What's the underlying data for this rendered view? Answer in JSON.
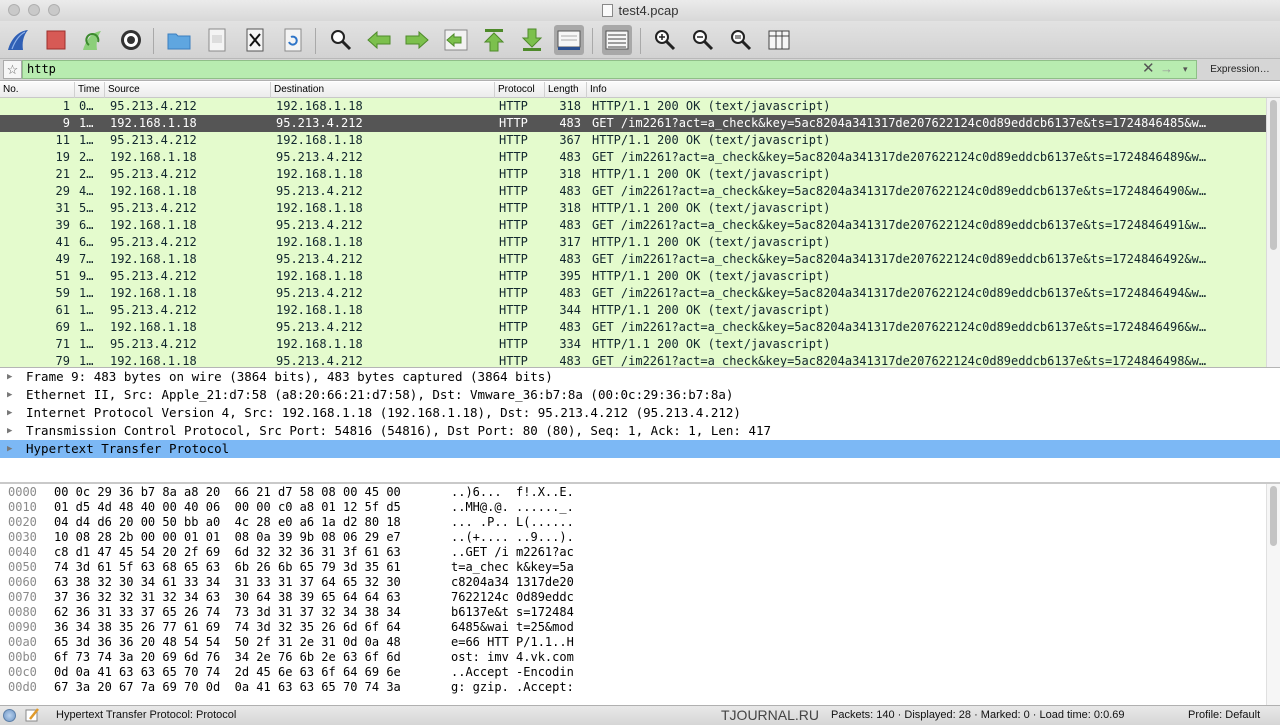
{
  "window": {
    "title": "test4.pcap",
    "doc_icon": "pcap-file-icon"
  },
  "toolbar": {
    "icons": [
      "shark-fin-start-icon",
      "stop-icon",
      "shark-fin-restart-icon",
      "gear-options-icon",
      "folder-open-icon",
      "document-icon",
      "close-file-icon",
      "reload-icon",
      "search-icon",
      "arrow-back-icon",
      "arrow-forward-icon",
      "go-to-packet-icon",
      "first-packet-icon",
      "last-packet-icon",
      "autoscroll-icon",
      "colorize-icon",
      "zoom-in-icon",
      "zoom-out-icon",
      "normal-size-icon",
      "resize-columns-icon"
    ]
  },
  "filter": {
    "value": "http",
    "expression_label": "Expression…"
  },
  "packet_list": {
    "columns": [
      "No.",
      "Time",
      "Source",
      "Destination",
      "Protocol",
      "Length",
      "Info"
    ],
    "selected_index": 1,
    "rows": [
      {
        "no": "1",
        "time": "0…",
        "src": "95.213.4.212",
        "dst": "192.168.1.18",
        "proto": "HTTP",
        "len": "318",
        "info": "HTTP/1.1 200 OK  (text/javascript)"
      },
      {
        "no": "9",
        "time": "1…",
        "src": "192.168.1.18",
        "dst": "95.213.4.212",
        "proto": "HTTP",
        "len": "483",
        "info": "GET /im2261?act=a_check&key=5ac8204a341317de207622124c0d89eddcb6137e&ts=1724846485&w…"
      },
      {
        "no": "11",
        "time": "1…",
        "src": "95.213.4.212",
        "dst": "192.168.1.18",
        "proto": "HTTP",
        "len": "367",
        "info": "HTTP/1.1 200 OK  (text/javascript)"
      },
      {
        "no": "19",
        "time": "2…",
        "src": "192.168.1.18",
        "dst": "95.213.4.212",
        "proto": "HTTP",
        "len": "483",
        "info": "GET /im2261?act=a_check&key=5ac8204a341317de207622124c0d89eddcb6137e&ts=1724846489&w…"
      },
      {
        "no": "21",
        "time": "2…",
        "src": "95.213.4.212",
        "dst": "192.168.1.18",
        "proto": "HTTP",
        "len": "318",
        "info": "HTTP/1.1 200 OK  (text/javascript)"
      },
      {
        "no": "29",
        "time": "4…",
        "src": "192.168.1.18",
        "dst": "95.213.4.212",
        "proto": "HTTP",
        "len": "483",
        "info": "GET /im2261?act=a_check&key=5ac8204a341317de207622124c0d89eddcb6137e&ts=1724846490&w…"
      },
      {
        "no": "31",
        "time": "5…",
        "src": "95.213.4.212",
        "dst": "192.168.1.18",
        "proto": "HTTP",
        "len": "318",
        "info": "HTTP/1.1 200 OK  (text/javascript)"
      },
      {
        "no": "39",
        "time": "6…",
        "src": "192.168.1.18",
        "dst": "95.213.4.212",
        "proto": "HTTP",
        "len": "483",
        "info": "GET /im2261?act=a_check&key=5ac8204a341317de207622124c0d89eddcb6137e&ts=1724846491&w…"
      },
      {
        "no": "41",
        "time": "6…",
        "src": "95.213.4.212",
        "dst": "192.168.1.18",
        "proto": "HTTP",
        "len": "317",
        "info": "HTTP/1.1 200 OK  (text/javascript)"
      },
      {
        "no": "49",
        "time": "7…",
        "src": "192.168.1.18",
        "dst": "95.213.4.212",
        "proto": "HTTP",
        "len": "483",
        "info": "GET /im2261?act=a_check&key=5ac8204a341317de207622124c0d89eddcb6137e&ts=1724846492&w…"
      },
      {
        "no": "51",
        "time": "9…",
        "src": "95.213.4.212",
        "dst": "192.168.1.18",
        "proto": "HTTP",
        "len": "395",
        "info": "HTTP/1.1 200 OK  (text/javascript)"
      },
      {
        "no": "59",
        "time": "1…",
        "src": "192.168.1.18",
        "dst": "95.213.4.212",
        "proto": "HTTP",
        "len": "483",
        "info": "GET /im2261?act=a_check&key=5ac8204a341317de207622124c0d89eddcb6137e&ts=1724846494&w…"
      },
      {
        "no": "61",
        "time": "1…",
        "src": "95.213.4.212",
        "dst": "192.168.1.18",
        "proto": "HTTP",
        "len": "344",
        "info": "HTTP/1.1 200 OK  (text/javascript)"
      },
      {
        "no": "69",
        "time": "1…",
        "src": "192.168.1.18",
        "dst": "95.213.4.212",
        "proto": "HTTP",
        "len": "483",
        "info": "GET /im2261?act=a_check&key=5ac8204a341317de207622124c0d89eddcb6137e&ts=1724846496&w…"
      },
      {
        "no": "71",
        "time": "1…",
        "src": "95.213.4.212",
        "dst": "192.168.1.18",
        "proto": "HTTP",
        "len": "334",
        "info": "HTTP/1.1 200 OK  (text/javascript)"
      },
      {
        "no": "79",
        "time": "1…",
        "src": "192.168.1.18",
        "dst": "95.213.4.212",
        "proto": "HTTP",
        "len": "483",
        "info": "GET /im2261?act=a_check&key=5ac8204a341317de207622124c0d89eddcb6137e&ts=1724846498&w…"
      }
    ]
  },
  "details": {
    "selected_index": 4,
    "rows": [
      "Frame 9: 483 bytes on wire (3864 bits), 483 bytes captured (3864 bits)",
      "Ethernet II, Src: Apple_21:d7:58 (a8:20:66:21:d7:58), Dst: Vmware_36:b7:8a (00:0c:29:36:b7:8a)",
      "Internet Protocol Version 4, Src: 192.168.1.18 (192.168.1.18), Dst: 95.213.4.212 (95.213.4.212)",
      "Transmission Control Protocol, Src Port: 54816 (54816), Dst Port: 80 (80), Seq: 1, Ack: 1, Len: 417",
      "Hypertext Transfer Protocol"
    ]
  },
  "bytes": {
    "rows": [
      {
        "off": "0000",
        "hex": "00 0c 29 36 b7 8a a8 20  66 21 d7 58 08 00 45 00",
        "ascii": "..)6...  f!.X..E."
      },
      {
        "off": "0010",
        "hex": "01 d5 4d 48 40 00 40 06  00 00 c0 a8 01 12 5f d5",
        "ascii": "..MH@.@. ......_."
      },
      {
        "off": "0020",
        "hex": "04 d4 d6 20 00 50 bb a0  4c 28 e0 a6 1a d2 80 18",
        "ascii": "... .P.. L(......"
      },
      {
        "off": "0030",
        "hex": "10 08 28 2b 00 00 01 01  08 0a 39 9b 08 06 29 e7",
        "ascii": "..(+.... ..9...)."
      },
      {
        "off": "0040",
        "hex": "c8 d1 47 45 54 20 2f 69  6d 32 32 36 31 3f 61 63",
        "ascii": "..GET /i m2261?ac"
      },
      {
        "off": "0050",
        "hex": "74 3d 61 5f 63 68 65 63  6b 26 6b 65 79 3d 35 61",
        "ascii": "t=a_chec k&key=5a"
      },
      {
        "off": "0060",
        "hex": "63 38 32 30 34 61 33 34  31 33 31 37 64 65 32 30",
        "ascii": "c8204a34 1317de20"
      },
      {
        "off": "0070",
        "hex": "37 36 32 32 31 32 34 63  30 64 38 39 65 64 64 63",
        "ascii": "7622124c 0d89eddc"
      },
      {
        "off": "0080",
        "hex": "62 36 31 33 37 65 26 74  73 3d 31 37 32 34 38 34",
        "ascii": "b6137e&t s=172484"
      },
      {
        "off": "0090",
        "hex": "36 34 38 35 26 77 61 69  74 3d 32 35 26 6d 6f 64",
        "ascii": "6485&wai t=25&mod"
      },
      {
        "off": "00a0",
        "hex": "65 3d 36 36 20 48 54 54  50 2f 31 2e 31 0d 0a 48",
        "ascii": "e=66 HTT P/1.1..H"
      },
      {
        "off": "00b0",
        "hex": "6f 73 74 3a 20 69 6d 76  34 2e 76 6b 2e 63 6f 6d",
        "ascii": "ost: imv 4.vk.com"
      },
      {
        "off": "00c0",
        "hex": "0d 0a 41 63 63 65 70 74  2d 45 6e 63 6f 64 69 6e",
        "ascii": "..Accept -Encodin"
      },
      {
        "off": "00d0",
        "hex": "67 3a 20 67 7a 69 70 0d  0a 41 63 63 65 70 74 3a",
        "ascii": "g: gzip. .Accept:"
      }
    ]
  },
  "status": {
    "field": "Hypertext Transfer Protocol: Protocol",
    "watermark": "TJOURNAL.RU",
    "packets": "Packets: 140 · Displayed: 28 · Marked: 0 · Load time: 0:0.69",
    "profile": "Profile: Default"
  },
  "colors": {
    "http_row": "#e4fbcd",
    "selected_row": "#555555",
    "filter_valid": "#b8ecb0",
    "detail_selected": "#7cb8f5"
  }
}
